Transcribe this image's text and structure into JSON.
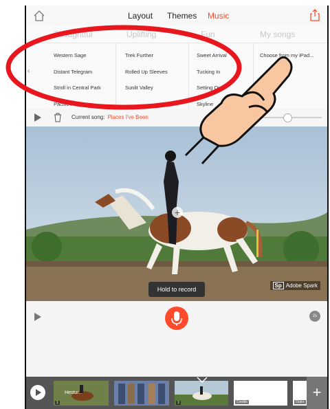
{
  "topbar": {
    "tabs": [
      "Layout",
      "Themes",
      "Music"
    ],
    "active_tab": "Music"
  },
  "music": {
    "categories": [
      "Thoughtful",
      "Uplifting",
      "Fun",
      "My songs"
    ],
    "columns": [
      [
        "Western Sage",
        "Distant Telegram",
        "Stroll in Central Park",
        "Pacific Pier"
      ],
      [
        "Trek Further",
        "Rolled Up Sleeves",
        "Sunlit Valley"
      ],
      [
        "Sweet Arrival",
        "Tucking In",
        "Setting Out",
        "Skyline"
      ],
      [
        "Choose from my iPad..."
      ]
    ]
  },
  "player": {
    "current_label": "Current song:",
    "current_song": "Places I've Been"
  },
  "photo": {
    "watermark_badge": "Sp",
    "watermark_text": "Adobe Spark"
  },
  "record": {
    "tooltip": "Hold to record",
    "duration_badge": "2s"
  },
  "timeline": {
    "slides": [
      {
        "title": "Hestur...",
        "num": "1"
      },
      {
        "title": "",
        "num": ""
      },
      {
        "title": "",
        "num": "3"
      },
      {
        "title": "",
        "tag": "Credits"
      },
      {
        "title": "",
        "tag": "Outro"
      }
    ]
  },
  "colors": {
    "accent": "#ff4b2b",
    "annotation": "#e8171e"
  }
}
